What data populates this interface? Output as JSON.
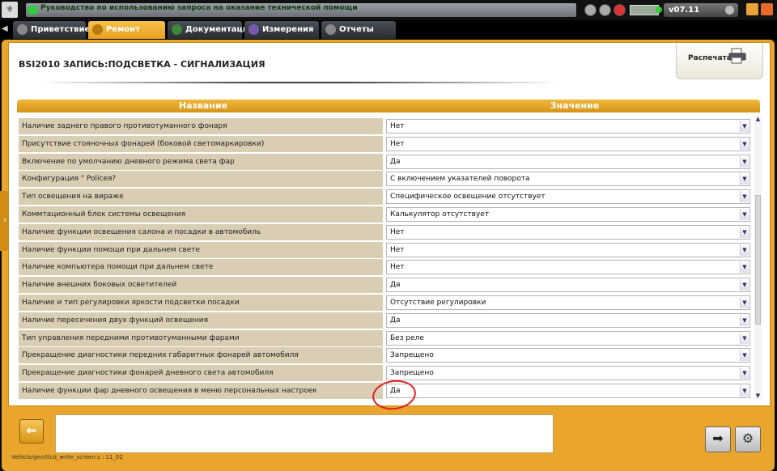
{
  "topbar": {
    "banner": "Руководство по использованию запроса на оказание технической помощи",
    "version": "v07.11",
    "colors": {
      "accent": "#e9a52c",
      "banner_dot": "#2ecc40"
    }
  },
  "tabs": [
    {
      "label": "Приветствие",
      "icon": "welcome-icon"
    },
    {
      "label": "Ремонт",
      "icon": "wrench-icon",
      "active": true
    },
    {
      "label": "Документация",
      "icon": "book-icon"
    },
    {
      "label": "Измерения",
      "icon": "wave-icon"
    },
    {
      "label": "Отчеты",
      "icon": "report-icon"
    }
  ],
  "header": {
    "title": "BSI2010  ЗАПИСЬ:ПОДСВЕТКА - СИГНАЛИЗАЦИЯ",
    "print_label": "Распечатать"
  },
  "table": {
    "col_name": "Название",
    "col_value": "Значение",
    "rows": [
      {
        "name": "Наличие заднего правого противотуманного фонаря",
        "value": "Нет"
      },
      {
        "name": "Присутствие стояночных фонарей (боковой светомаркировки)",
        "value": "Нет"
      },
      {
        "name": "Включение по умолчанию дневного режима света фар",
        "value": "Да"
      },
      {
        "name": "Конфигурация \" Policeя?",
        "value": "С включением указателей поворота"
      },
      {
        "name": "Тип освещения на вираже",
        "value": "Специфическое освещение отсутствует"
      },
      {
        "name": "Коммтационный блок системы освещения",
        "value": "Калькулятор отсутствует"
      },
      {
        "name": "Наличие функции освещения салона и посадки в автомобиль",
        "value": "Нет"
      },
      {
        "name": "Наличие функции помощи при дальнем свете",
        "value": "Нет"
      },
      {
        "name": "Наличие компьютера помощи при дальнем свете",
        "value": "Нет"
      },
      {
        "name": "Наличие внешних боковых осветителей",
        "value": "Да"
      },
      {
        "name": "Наличие и тип регулировки яркости подсветки посадки",
        "value": "Отсутствие регулировки"
      },
      {
        "name": "Наличие пересечения двух функций освещения",
        "value": "Да"
      },
      {
        "name": "Тип управления передними противотуманными фарами",
        "value": "Без реле"
      },
      {
        "name": "Прекращение диагностики передних габаритных фонарей автомобиля",
        "value": "Запрещено"
      },
      {
        "name": "Прекращение диагностики фонарей дневного света автомобиля",
        "value": "Запрещено"
      },
      {
        "name": "Наличие функции фар дневного освещения в меню персональных настроек",
        "value": "Да"
      }
    ]
  },
  "status": {
    "path": "Vehicle/gen/tlcd_write_screen.s : 11_02"
  }
}
